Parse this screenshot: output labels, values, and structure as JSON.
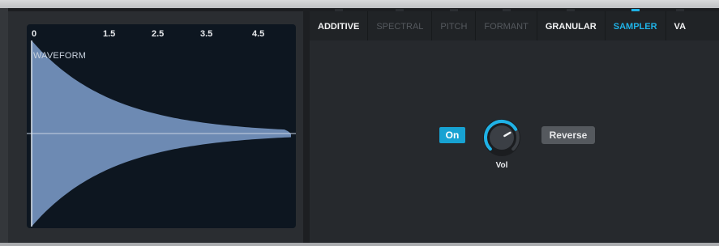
{
  "waveform": {
    "title": "WAVEFORM",
    "ticks": [
      "0",
      "1.5",
      "2.5",
      "3.5",
      "4.5"
    ],
    "fill_color": "#6d8ab3",
    "background_color": "#0d1620"
  },
  "tabs": [
    {
      "label": "ADDITIVE",
      "state": "normal"
    },
    {
      "label": "SPECTRAL",
      "state": "disabled"
    },
    {
      "label": "PITCH",
      "state": "disabled"
    },
    {
      "label": "FORMANT",
      "state": "disabled"
    },
    {
      "label": "GRANULAR",
      "state": "normal"
    },
    {
      "label": "SAMPLER",
      "state": "active"
    },
    {
      "label": "VA",
      "state": "normal"
    }
  ],
  "sampler": {
    "on_label": "On",
    "on_active": true,
    "volume_label": "Vol",
    "volume_knob_value": 0.72,
    "reverse_label": "Reverse",
    "reverse_active": false
  },
  "colors": {
    "accent": "#1fb2e6",
    "panel": "#26292d",
    "disabled_text": "#55595e"
  }
}
